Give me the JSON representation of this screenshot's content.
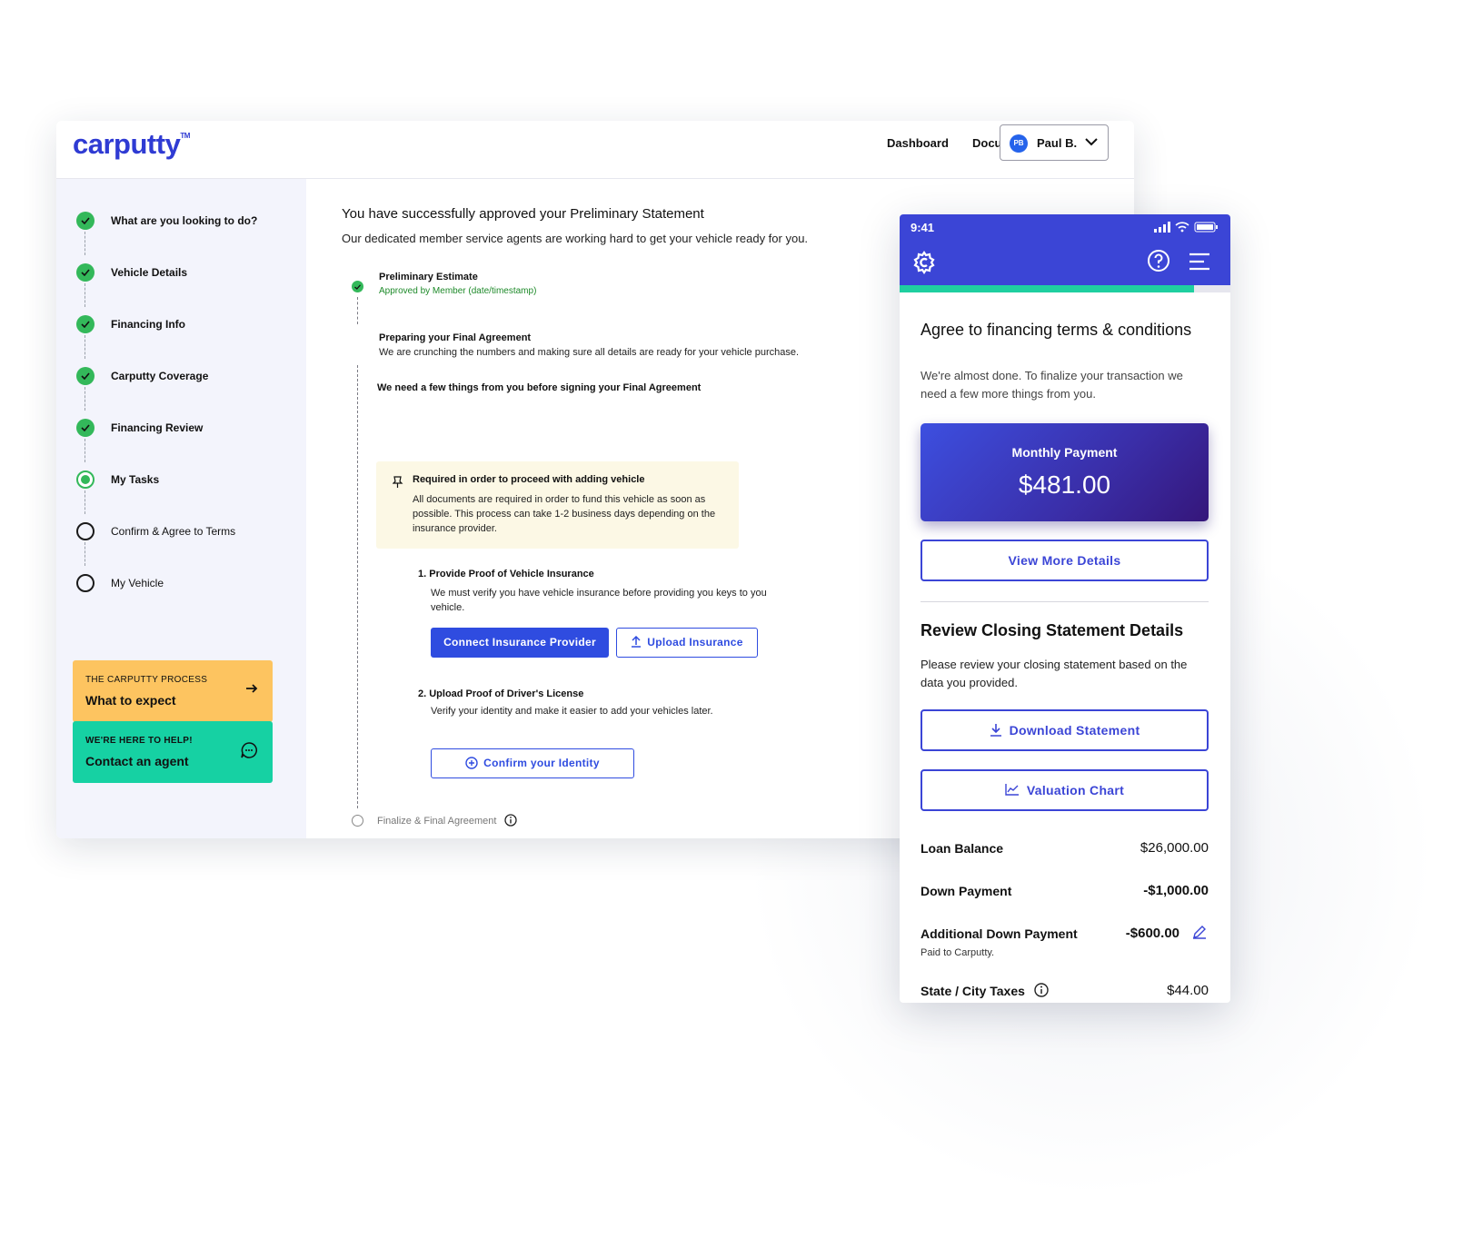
{
  "desktop": {
    "logo": "carputty",
    "logo_tm": "TM",
    "nav": {
      "dashboard": "Dashboard",
      "documents": "Documents"
    },
    "user": {
      "initials": "PB",
      "name": "Paul B."
    },
    "steps": [
      {
        "label": "What are you looking to do?",
        "state": "done"
      },
      {
        "label": "Vehicle Details",
        "state": "done"
      },
      {
        "label": "Financing Info",
        "state": "done"
      },
      {
        "label": "Carputty Coverage",
        "state": "done"
      },
      {
        "label": "Financing Review",
        "state": "done"
      },
      {
        "label": "My Tasks",
        "state": "current"
      },
      {
        "label": "Confirm & Agree to Terms",
        "state": "todo"
      },
      {
        "label": "My Vehicle",
        "state": "todo"
      }
    ],
    "promo_process": {
      "kicker": "THE CARPUTTY PROCESS",
      "title": "What to expect",
      "color": "#fdc460"
    },
    "promo_help": {
      "kicker": "WE'RE HERE TO HELP!",
      "title": "Contact an agent",
      "color": "#16d1a3"
    },
    "main": {
      "heading": "You have successfully approved your Preliminary Statement",
      "subheading": "Our dedicated member service agents are working hard to get your vehicle ready for you.",
      "prelim_title": "Preliminary Estimate",
      "prelim_status": "Approved by Member (date/timestamp)",
      "preparing_title": "Preparing your Final Agreement",
      "preparing_desc": "We are crunching the numbers and making sure all details are ready for your vehicle purchase.",
      "need_title": "We need a few things from you before signing your Final Agreement",
      "required_title": "Required in order to proceed with adding vehicle",
      "required_desc": "All documents are required in order to fund this vehicle as soon as possible. This process can take 1-2 business days depending on the insurance provider.",
      "task1_title": "1. Provide Proof of Vehicle Insurance",
      "task1_desc": "We must verify you have vehicle insurance before providing you keys to you vehicle.",
      "btn_connect": "Connect Insurance Provider",
      "btn_upload": "Upload Insurance",
      "task2_title": "2. Upload Proof of Driver's License",
      "task2_desc": "Verify your identity and make it easier to add your vehicles later.",
      "btn_confirm": "Confirm your Identity",
      "final_label": "Finalize & Final Agreement"
    }
  },
  "phone": {
    "time": "9:41",
    "progress": 0.89,
    "title": "Agree to financing terms & conditions",
    "intro": "We're almost done. To finalize your transaction we need a few more things from you.",
    "monthly_label": "Monthly Payment",
    "monthly_value": "$481.00",
    "btn_details": "View More Details",
    "review_title": "Review Closing Statement Details",
    "review_desc": "Please review your closing statement based on the data you provided.",
    "btn_download": "Download Statement",
    "btn_valuation": "Valuation Chart",
    "loan_label": "Loan Balance",
    "loan_value": "$26,000.00",
    "down_label": "Down Payment",
    "down_value": "-$1,000.00",
    "addl_label": "Additional Down Payment",
    "addl_value": "-$600.00",
    "addl_note": "Paid to Carputty.",
    "tax_label": "State / City Taxes",
    "tax_value": "$44.00"
  }
}
